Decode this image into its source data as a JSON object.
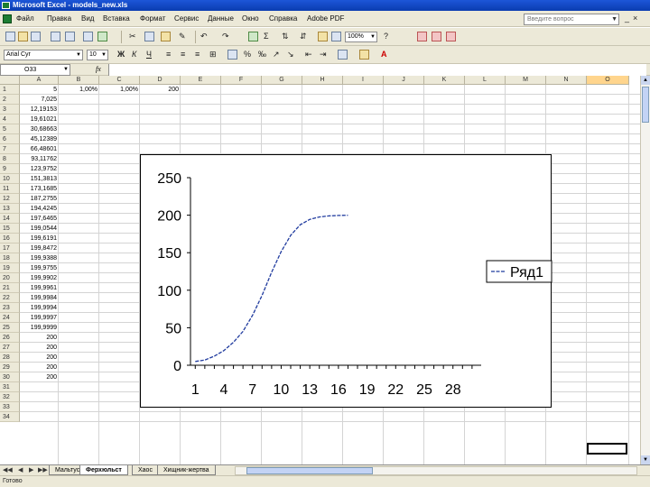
{
  "window": {
    "title": "Microsoft Excel - models_new.xls"
  },
  "menu": {
    "items": [
      "Файл",
      "Правка",
      "Вид",
      "Вставка",
      "Формат",
      "Сервис",
      "Данные",
      "Окно",
      "Справка",
      "Adobe PDF"
    ],
    "help_placeholder": "Введите вопрос"
  },
  "toolbar": {
    "zoom": "100%",
    "font_name": "Arial Cyr",
    "font_size": "10"
  },
  "formula": {
    "cell_ref": "O33",
    "fx": "fx",
    "content": ""
  },
  "columns": [
    "A",
    "B",
    "C",
    "D",
    "E",
    "F",
    "G",
    "H",
    "I",
    "J",
    "K",
    "L",
    "M",
    "N",
    "O"
  ],
  "selected_column": "O",
  "rows": [
    "1",
    "2",
    "3",
    "4",
    "5",
    "6",
    "7",
    "8",
    "9",
    "10",
    "11",
    "12",
    "13",
    "14",
    "15",
    "16",
    "17",
    "18",
    "19",
    "20",
    "21",
    "22",
    "23",
    "24",
    "25",
    "26",
    "27",
    "28",
    "29",
    "30",
    "31",
    "32",
    "33",
    "34"
  ],
  "cells": {
    "B1": "1,00%",
    "C1": "1,00%",
    "D1": "200",
    "A": [
      "5",
      "7,025",
      "12,19153",
      "19,61021",
      "30,68663",
      "45,12389",
      "66,48601",
      "93,11762",
      "123,9752",
      "151,3813",
      "173,1685",
      "187,2755",
      "194,4245",
      "197,6465",
      "199,0544",
      "199,6191",
      "199,8472",
      "199,9388",
      "199,9755",
      "199,9902",
      "199,9961",
      "199,9984",
      "199,9994",
      "199,9997",
      "199,9999",
      "200",
      "200",
      "200",
      "200",
      "200"
    ]
  },
  "chart_data": {
    "type": "line",
    "x": [
      1,
      2,
      3,
      4,
      5,
      6,
      7,
      8,
      9,
      10,
      11,
      12,
      13,
      14,
      15,
      16,
      17
    ],
    "series": [
      {
        "name": "Ряд1",
        "values": [
          5,
          7.025,
          12.19,
          19.61,
          30.69,
          45.12,
          66.49,
          93.12,
          123.98,
          151.38,
          173.17,
          187.28,
          194.42,
          197.65,
          199.05,
          199.62,
          199.85
        ]
      }
    ],
    "xticks": [
      "1",
      "4",
      "7",
      "10",
      "13",
      "16",
      "19",
      "22",
      "25",
      "28"
    ],
    "yticks": [
      "0",
      "50",
      "100",
      "150",
      "200",
      "250"
    ],
    "xlim": [
      1,
      30
    ],
    "ylim": [
      0,
      250
    ],
    "legend": "right",
    "color": "#1f3a9e"
  },
  "sheet_tabs": [
    "Мальтус",
    "Ферхюльст",
    "Хаос",
    "Хищник-жертва"
  ],
  "active_tab": "Ферхюльст",
  "status": "Готово"
}
